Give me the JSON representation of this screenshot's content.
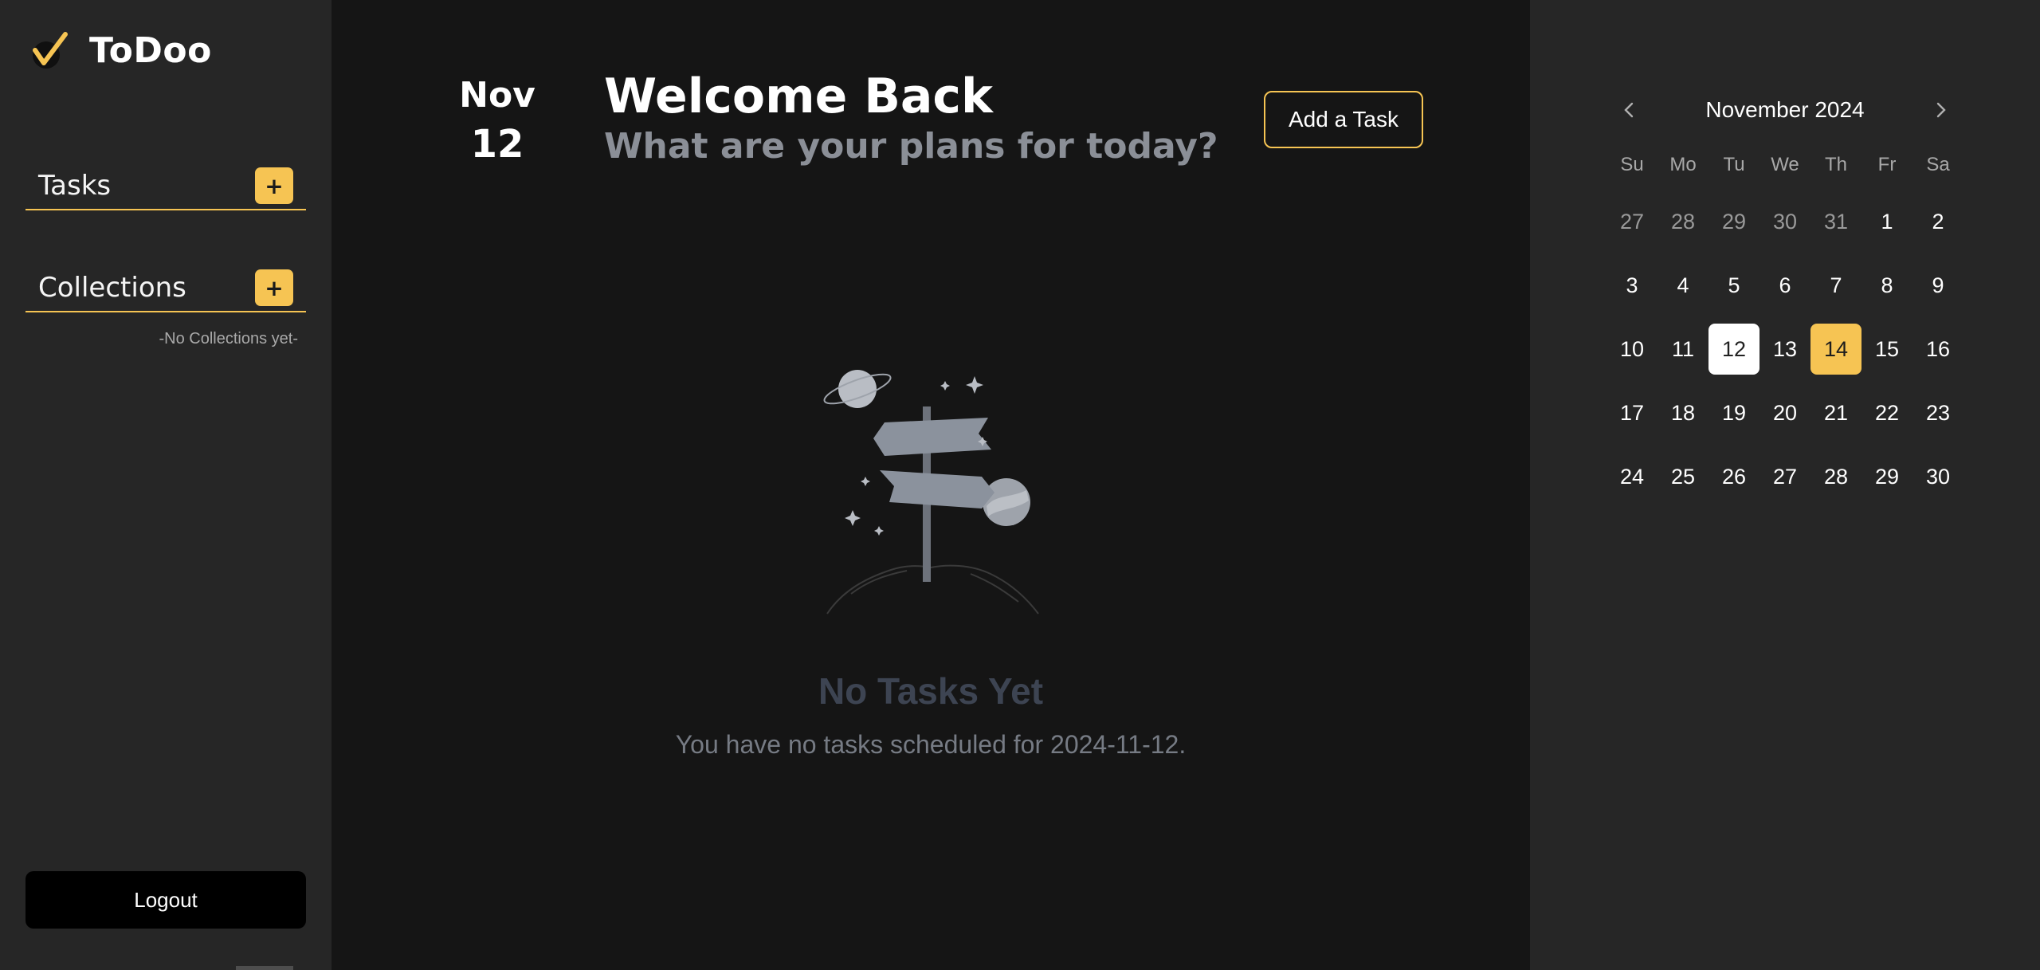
{
  "app": {
    "name": "ToDoo"
  },
  "sidebar": {
    "tasks_label": "Tasks",
    "collections_label": "Collections",
    "add_symbol": "+",
    "empty_collections": "-No Collections yet-",
    "logout_label": "Logout"
  },
  "header": {
    "month": "Nov",
    "day": "12",
    "title": "Welcome Back",
    "subtitle": "What are your plans for today?",
    "add_task_label": "Add a Task"
  },
  "empty_state": {
    "title": "No Tasks Yet",
    "description": "You have no tasks scheduled for 2024-11-12."
  },
  "calendar": {
    "title": "November 2024",
    "prev_icon": "chevron-left-icon",
    "next_icon": "chevron-right-icon",
    "weekdays": [
      "Su",
      "Mo",
      "Tu",
      "We",
      "Th",
      "Fr",
      "Sa"
    ],
    "days": [
      {
        "label": "27",
        "muted": true
      },
      {
        "label": "28",
        "muted": true
      },
      {
        "label": "29",
        "muted": true
      },
      {
        "label": "30",
        "muted": true
      },
      {
        "label": "31",
        "muted": true
      },
      {
        "label": "1"
      },
      {
        "label": "2"
      },
      {
        "label": "3"
      },
      {
        "label": "4"
      },
      {
        "label": "5"
      },
      {
        "label": "6"
      },
      {
        "label": "7"
      },
      {
        "label": "8"
      },
      {
        "label": "9"
      },
      {
        "label": "10"
      },
      {
        "label": "11"
      },
      {
        "label": "12",
        "today": true
      },
      {
        "label": "13"
      },
      {
        "label": "14",
        "selected": true
      },
      {
        "label": "15"
      },
      {
        "label": "16"
      },
      {
        "label": "17"
      },
      {
        "label": "18"
      },
      {
        "label": "19"
      },
      {
        "label": "20"
      },
      {
        "label": "21"
      },
      {
        "label": "22"
      },
      {
        "label": "23"
      },
      {
        "label": "24"
      },
      {
        "label": "25"
      },
      {
        "label": "26"
      },
      {
        "label": "27"
      },
      {
        "label": "28"
      },
      {
        "label": "29"
      },
      {
        "label": "30"
      }
    ]
  },
  "colors": {
    "accent": "#f6c453",
    "sidebar_bg": "#262626",
    "main_bg": "#151515",
    "muted_text": "#8b8f97"
  }
}
